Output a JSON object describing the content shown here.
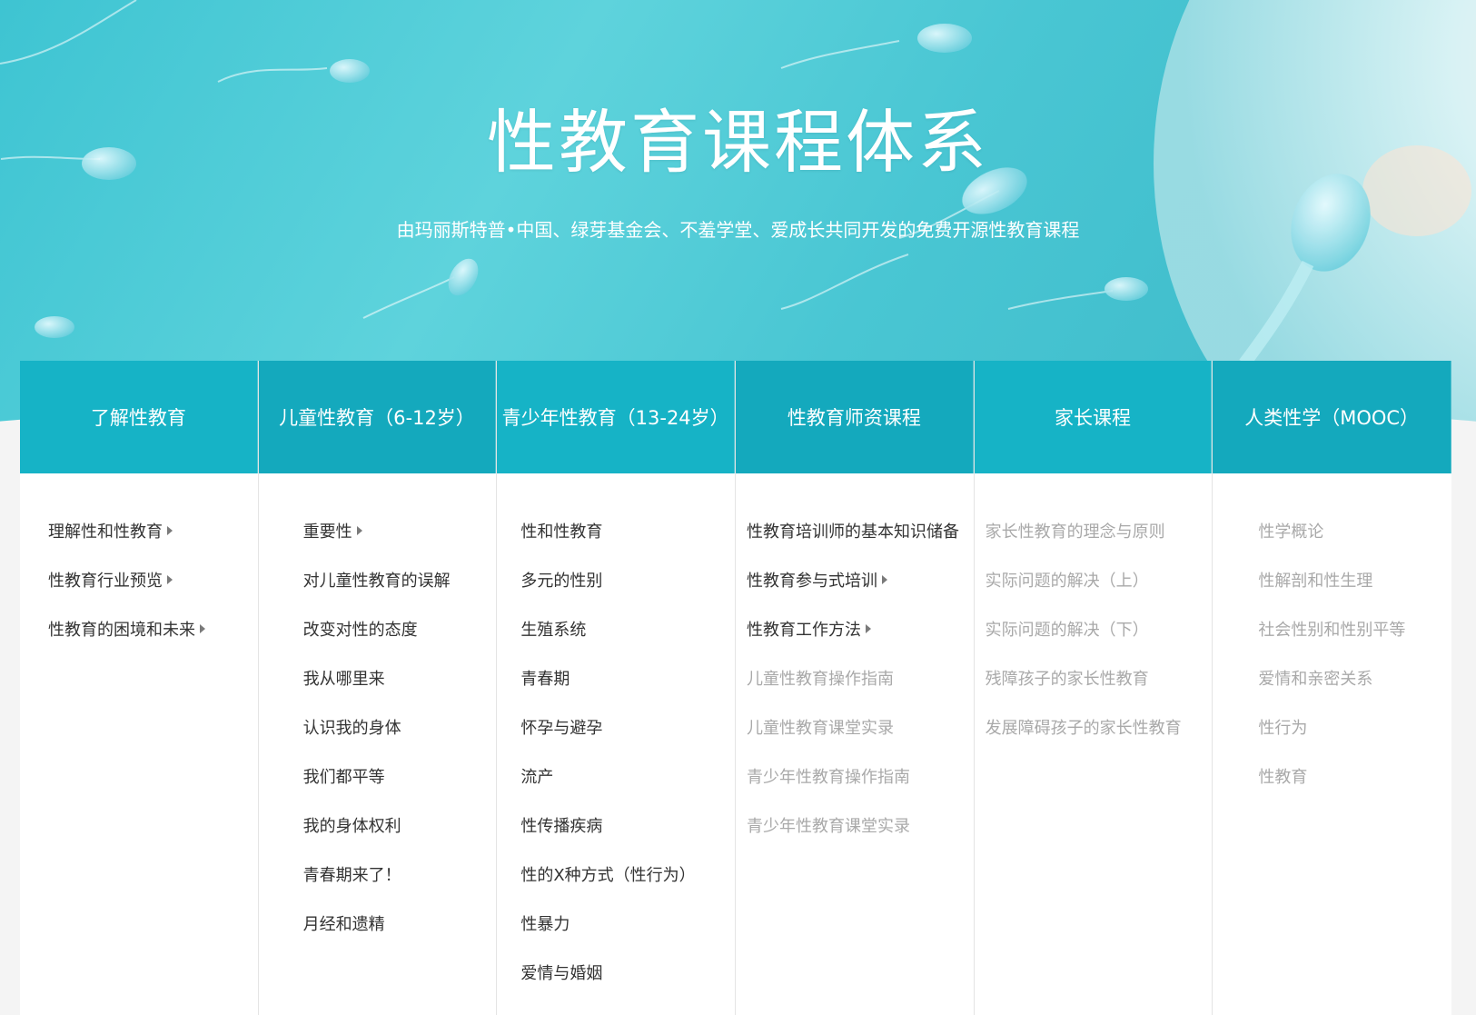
{
  "hero": {
    "title": "性教育课程体系",
    "subtitle": "由玛丽斯特普•中国、绿芽基金会、不羞学堂、爱成长共同开发的免费开源性教育课程"
  },
  "colors": {
    "header_bg": "#16b3c6",
    "text": "#333333",
    "muted_text": "#a9a9a9",
    "hero_bg": "#4fcbd6"
  },
  "columns": [
    {
      "title": "了解性教育",
      "items": [
        {
          "label": "理解性和性教育",
          "arrow": true,
          "muted": false
        },
        {
          "label": "性教育行业预览",
          "arrow": true,
          "muted": false
        },
        {
          "label": "性教育的困境和未来",
          "arrow": true,
          "muted": false
        }
      ]
    },
    {
      "title": "儿童性教育（6-12岁）",
      "items": [
        {
          "label": "重要性",
          "arrow": true,
          "muted": false
        },
        {
          "label": "对儿童性教育的误解",
          "arrow": false,
          "muted": false
        },
        {
          "label": "改变对性的态度",
          "arrow": false,
          "muted": false
        },
        {
          "label": "我从哪里来",
          "arrow": false,
          "muted": false
        },
        {
          "label": "认识我的身体",
          "arrow": false,
          "muted": false
        },
        {
          "label": "我们都平等",
          "arrow": false,
          "muted": false
        },
        {
          "label": "我的身体权利",
          "arrow": false,
          "muted": false
        },
        {
          "label": "青春期来了！",
          "arrow": false,
          "muted": false
        },
        {
          "label": "月经和遗精",
          "arrow": false,
          "muted": false
        }
      ]
    },
    {
      "title": "青少年性教育（13-24岁）",
      "items": [
        {
          "label": "性和性教育",
          "arrow": false,
          "muted": false
        },
        {
          "label": "多元的性别",
          "arrow": false,
          "muted": false
        },
        {
          "label": "生殖系统",
          "arrow": false,
          "muted": false
        },
        {
          "label": "青春期",
          "arrow": false,
          "muted": false
        },
        {
          "label": "怀孕与避孕",
          "arrow": false,
          "muted": false
        },
        {
          "label": "流产",
          "arrow": false,
          "muted": false
        },
        {
          "label": "性传播疾病",
          "arrow": false,
          "muted": false
        },
        {
          "label": "性的X种方式（性行为）",
          "arrow": false,
          "muted": false
        },
        {
          "label": "性暴力",
          "arrow": false,
          "muted": false
        },
        {
          "label": "爱情与婚姻",
          "arrow": false,
          "muted": false
        }
      ]
    },
    {
      "title": "性教育师资课程",
      "items": [
        {
          "label": "性教育培训师的基本知识储备",
          "arrow": false,
          "muted": false
        },
        {
          "label": "性教育参与式培训",
          "arrow": true,
          "muted": false
        },
        {
          "label": "性教育工作方法",
          "arrow": true,
          "muted": false
        },
        {
          "label": "儿童性教育操作指南",
          "arrow": false,
          "muted": true
        },
        {
          "label": "儿童性教育课堂实录",
          "arrow": false,
          "muted": true
        },
        {
          "label": "青少年性教育操作指南",
          "arrow": false,
          "muted": true
        },
        {
          "label": "青少年性教育课堂实录",
          "arrow": false,
          "muted": true
        }
      ]
    },
    {
      "title": "家长课程",
      "items": [
        {
          "label": "家长性教育的理念与原则",
          "arrow": false,
          "muted": true
        },
        {
          "label": "实际问题的解决（上）",
          "arrow": false,
          "muted": true
        },
        {
          "label": "实际问题的解决（下）",
          "arrow": false,
          "muted": true
        },
        {
          "label": "残障孩子的家长性教育",
          "arrow": false,
          "muted": true
        },
        {
          "label": "发展障碍孩子的家长性教育",
          "arrow": false,
          "muted": true
        }
      ]
    },
    {
      "title": "人类性学（MOOC）",
      "items": [
        {
          "label": "性学概论",
          "arrow": false,
          "muted": true
        },
        {
          "label": "性解剖和性生理",
          "arrow": false,
          "muted": true
        },
        {
          "label": "社会性别和性别平等",
          "arrow": false,
          "muted": true
        },
        {
          "label": "爱情和亲密关系",
          "arrow": false,
          "muted": true
        },
        {
          "label": "性行为",
          "arrow": false,
          "muted": true
        },
        {
          "label": "性教育",
          "arrow": false,
          "muted": true
        }
      ]
    }
  ]
}
